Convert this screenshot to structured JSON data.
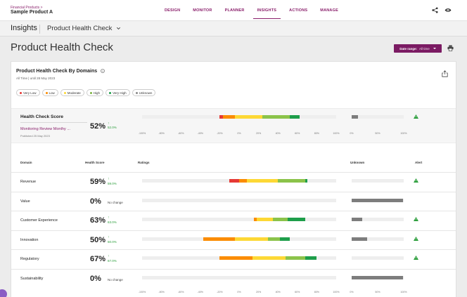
{
  "header": {
    "crumb": "Financial Products >",
    "product": "Sample Product A",
    "nav": [
      {
        "label": "DESIGN",
        "active": false
      },
      {
        "label": "MONITOR",
        "active": false
      },
      {
        "label": "PLANNER",
        "active": false
      },
      {
        "label": "INSIGHTS",
        "active": true
      },
      {
        "label": "ACTIONS",
        "active": false
      },
      {
        "label": "MANAGE",
        "active": false
      }
    ]
  },
  "subheader": {
    "title": "Insights",
    "page": "Product Health Check"
  },
  "page": {
    "title": "Product Health Check",
    "date_range_label": "Date range:",
    "date_range_value": "All time"
  },
  "card": {
    "title": "Product Health Check By Domains",
    "subtitle": "All Time | until 28 May 2023",
    "legend": [
      {
        "label": "Very Low",
        "color": "#e53935"
      },
      {
        "label": "Low",
        "color": "#fb8c00"
      },
      {
        "label": "Moderate",
        "color": "#fdd835"
      },
      {
        "label": "High",
        "color": "#7cb342"
      },
      {
        "label": "Very High",
        "color": "#1e9e4a"
      },
      {
        "label": "Unknown",
        "color": "#8a8a8a"
      }
    ]
  },
  "health_check": {
    "label": "Health Check Score",
    "link": "Monitoring Review Monthy ...",
    "published": "Published 25 May 2023",
    "score": "52%",
    "change_arrow": "↑",
    "change": "52.0%",
    "ratings": [
      {
        "level": "very_low",
        "from": -20,
        "to": -17
      },
      {
        "level": "low",
        "from": -17,
        "to": -4
      },
      {
        "level": "moderate",
        "from": -4,
        "to": 24
      },
      {
        "level": "high",
        "from": 24,
        "to": 52
      },
      {
        "level": "very_high",
        "from": 52,
        "to": 62
      }
    ],
    "unknown": 12,
    "alert": true
  },
  "table": {
    "headers": {
      "domain": "Domain",
      "score": "Health Score",
      "ratings": "Ratings",
      "unknown": "Unknown",
      "alert": "Alert"
    },
    "rows": [
      {
        "domain": "Revenue",
        "score": "59%",
        "change_arrow": "↑",
        "change": "59.0%",
        "ratings": [
          {
            "level": "very_low",
            "from": -10,
            "to": 0
          },
          {
            "level": "low",
            "from": 0,
            "to": 8
          },
          {
            "level": "moderate",
            "from": 8,
            "to": 40
          },
          {
            "level": "high",
            "from": 40,
            "to": 68
          },
          {
            "level": "very_high",
            "from": 68,
            "to": 70
          }
        ],
        "unknown": 0,
        "alert": true
      },
      {
        "domain": "Value",
        "score": "0%",
        "change_arrow": "",
        "change": "",
        "nochange": "No change",
        "ratings": [],
        "unknown": 98,
        "alert": false
      },
      {
        "domain": "Customer Experience",
        "score": "63%",
        "change_arrow": "↑",
        "change": "63.0%",
        "ratings": [
          {
            "level": "low",
            "from": 15,
            "to": 18
          },
          {
            "level": "moderate",
            "from": 18,
            "to": 35
          },
          {
            "level": "high",
            "from": 35,
            "to": 50
          },
          {
            "level": "very_high",
            "from": 50,
            "to": 68
          }
        ],
        "unknown": 20,
        "alert": true
      },
      {
        "domain": "Innovation",
        "score": "50%",
        "change_arrow": "↑",
        "change": "50.0%",
        "ratings": [
          {
            "level": "low",
            "from": -37,
            "to": -4
          },
          {
            "level": "moderate",
            "from": -4,
            "to": 30
          },
          {
            "level": "high",
            "from": 30,
            "to": 42
          },
          {
            "level": "very_high",
            "from": 42,
            "to": 52
          }
        ],
        "unknown": 30,
        "alert": true
      },
      {
        "domain": "Regulatory",
        "score": "67%",
        "change_arrow": "↑",
        "change": "67.0%",
        "ratings": [
          {
            "level": "low",
            "from": -20,
            "to": 14
          },
          {
            "level": "moderate",
            "from": 14,
            "to": 48
          },
          {
            "level": "high",
            "from": 48,
            "to": 68
          },
          {
            "level": "very_high",
            "from": 68,
            "to": 80
          }
        ],
        "unknown": 0,
        "alert": true
      },
      {
        "domain": "Sustainability",
        "score": "0%",
        "change_arrow": "",
        "change": "",
        "nochange": "No change",
        "ratings": [],
        "unknown": 98,
        "alert": false
      }
    ]
  },
  "axis": {
    "ratings_ticks": [
      "-100%",
      "-80%",
      "-60%",
      "-40%",
      "-20%",
      "0%",
      "20%",
      "40%",
      "60%",
      "80%",
      "100%"
    ],
    "unknown_ticks": [
      "0%",
      "50%",
      "100%"
    ]
  },
  "colors": {
    "very_low": "#e53935",
    "low": "#fb8c00",
    "moderate": "#fdd835",
    "high": "#8bc34a",
    "very_high": "#1e9e4a",
    "unknown": "#7d7d7d",
    "accent": "#8a1f6b",
    "alert": "#2a9d3a"
  }
}
